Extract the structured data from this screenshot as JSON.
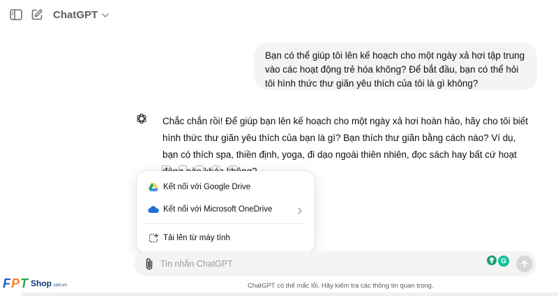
{
  "header": {
    "model_name": "ChatGPT",
    "icons": {
      "sidebar": "sidebar-toggle-icon",
      "new_chat": "new-chat-icon",
      "model_menu": "chevron-down-icon"
    }
  },
  "conversation": {
    "user_message": "Bạn có thể giúp tôi lên kế hoạch cho một ngày xả hơi tập trung vào các hoạt động trẻ hóa không? Để bắt đầu, bạn có thể hỏi tôi hình thức thư giãn yêu thích của tôi là gì không?",
    "assistant_message": "Chắc chắn rồi! Để giúp bạn lên kế hoạch cho một ngày xả hơi hoàn hảo, hãy cho tôi biết hình thức thư giãn yêu thích của bạn là gì? Bạn thích thư giãn bằng cách nào? Ví dụ, bạn có thích spa, thiền định, yoga, đi dạo ngoài thiên nhiên, đọc sách hay bất cứ hoạt động nào khác không?"
  },
  "attach_menu": {
    "items": [
      {
        "label": "Kết nối với Google Drive",
        "icon": "google-drive-icon"
      },
      {
        "label": "Kết nối với Microsoft OneDrive",
        "icon": "onedrive-icon",
        "has_submenu": true
      },
      {
        "label": "Tải lên từ máy tính",
        "icon": "upload-computer-icon"
      }
    ]
  },
  "composer": {
    "placeholder": "Tin nhắn ChatGPT",
    "extension_g_label": "G"
  },
  "footer": {
    "disclaimer": "ChatGPT có thể mắc lỗi. Hãy kiểm tra các thông tin quan trọng."
  },
  "watermark": {
    "letters": [
      "F",
      "P",
      "T"
    ],
    "shop": "Shop",
    "domain": ".com.vn",
    "colors": {
      "f": "#1f5fb8",
      "p": "#f58220",
      "t": "#2ca54a"
    }
  },
  "colors": {
    "bubble": "#f4f4f4",
    "text": "#0d0d0d",
    "muted": "#5d5d5d",
    "gdrive_green": "#1fa463",
    "gdrive_yellow": "#ffd04b",
    "gdrive_blue": "#4688f4",
    "onedrive_blue": "#1e6ed8"
  }
}
